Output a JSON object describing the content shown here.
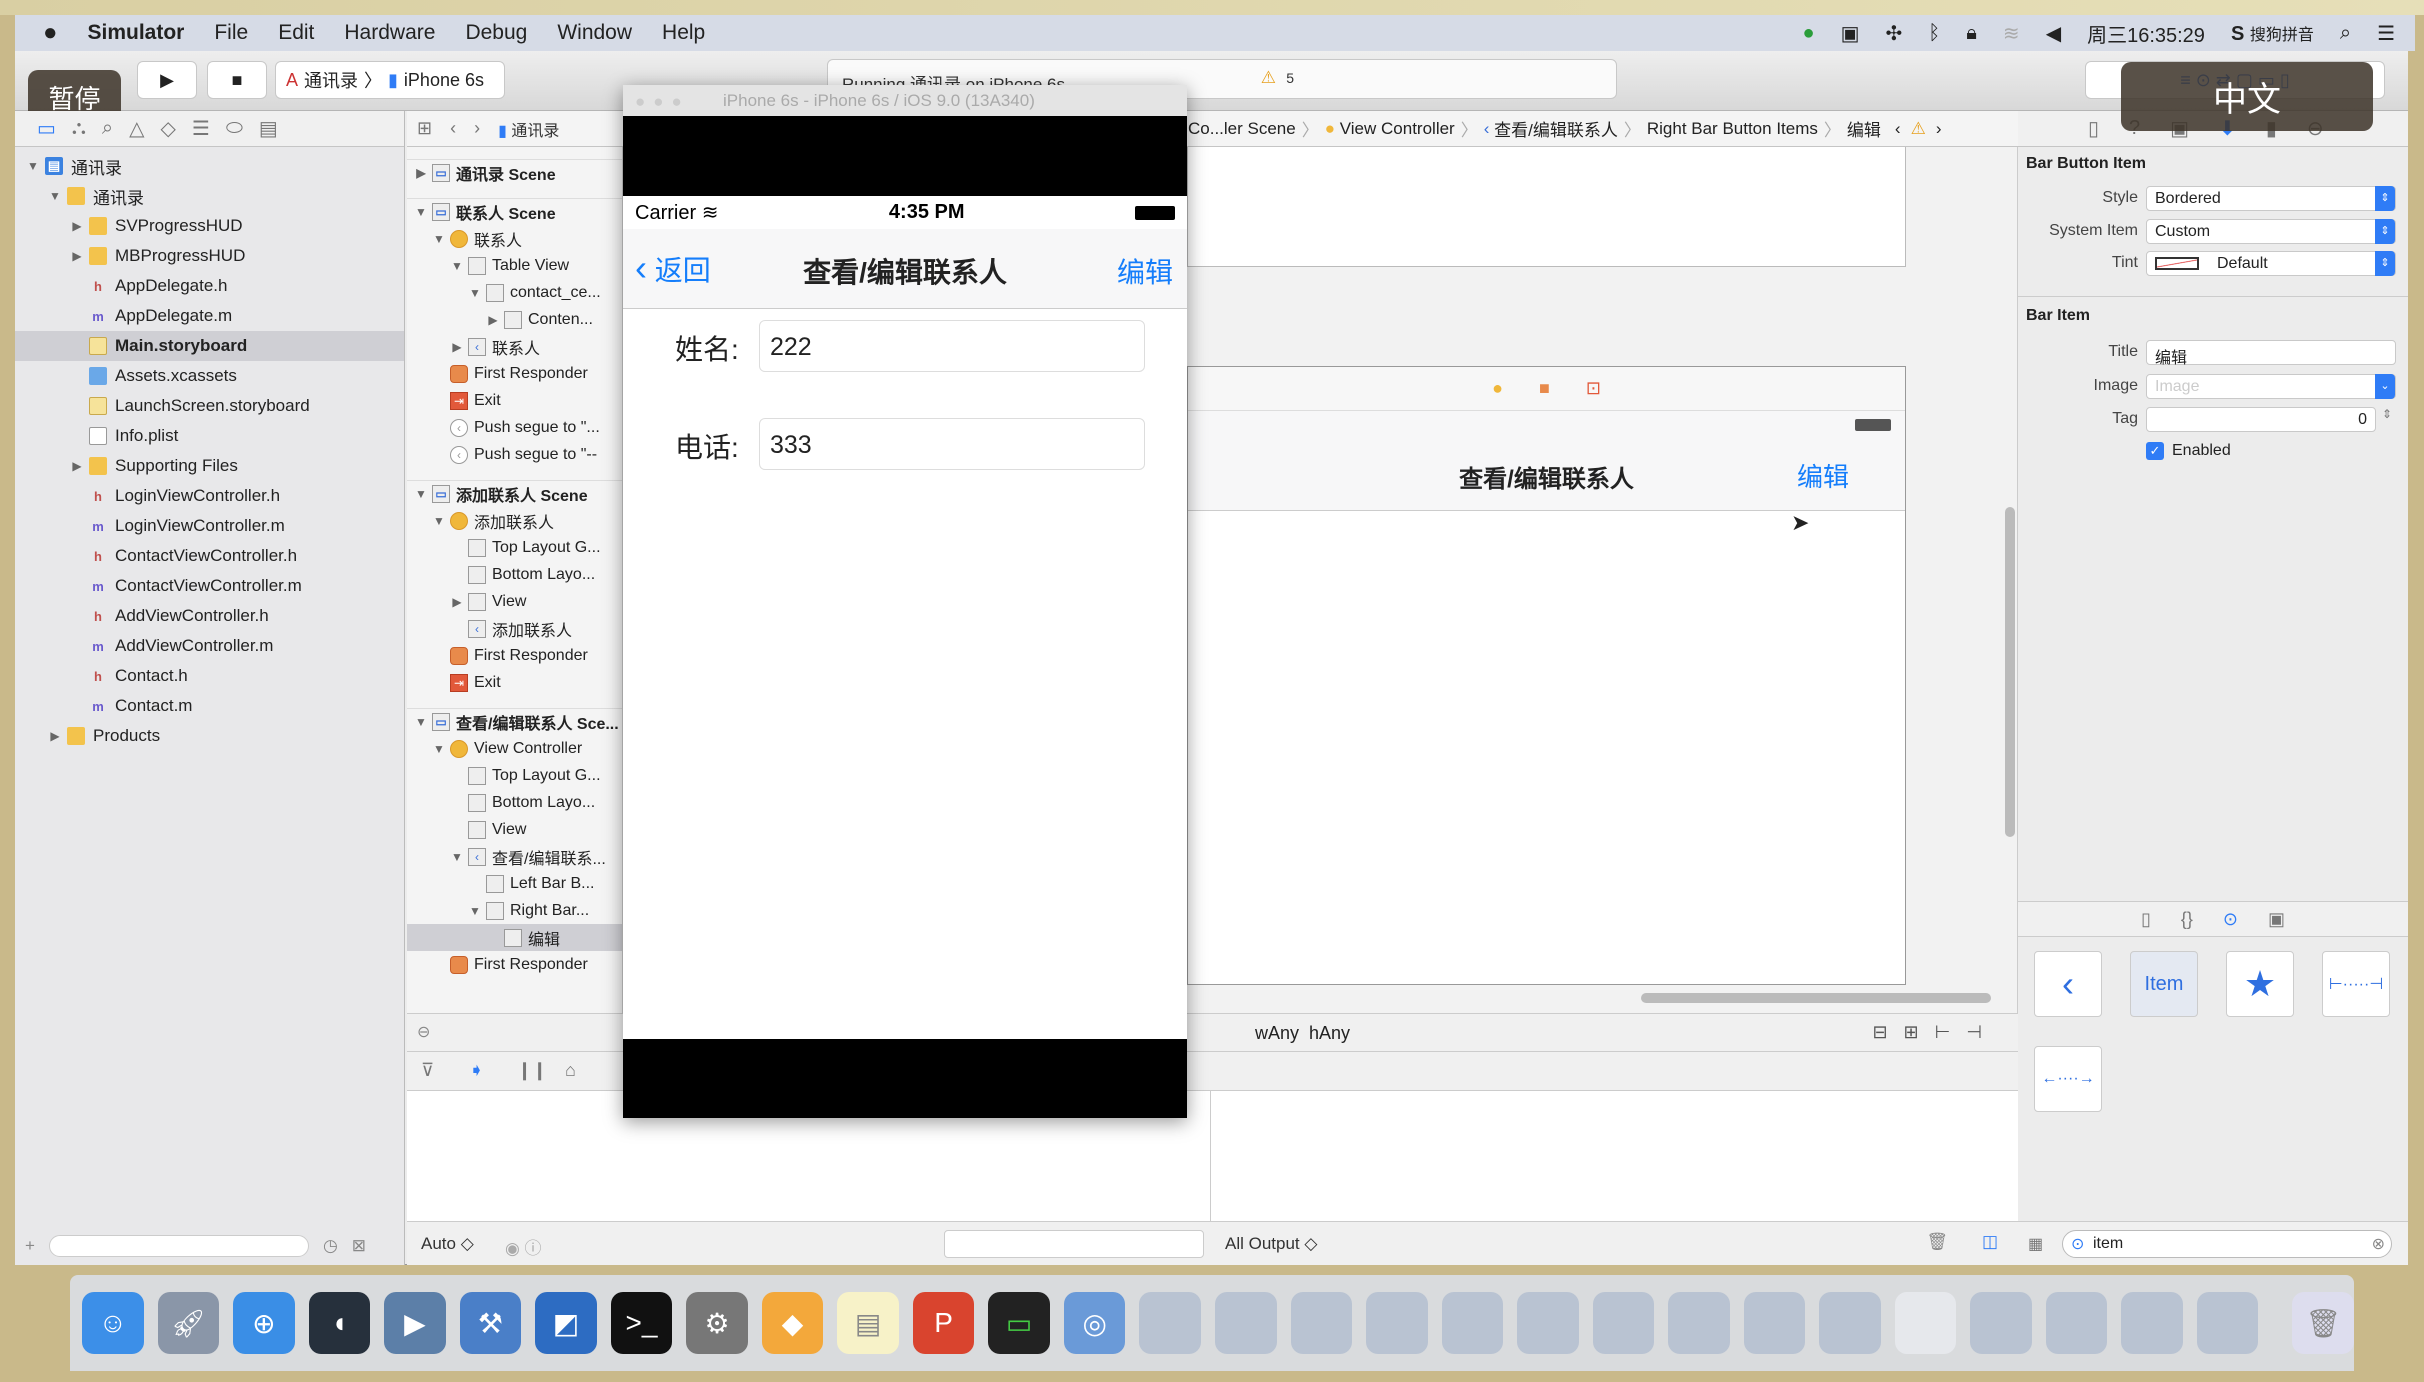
{
  "menubar": {
    "apple": "",
    "app": "Simulator",
    "items": [
      "File",
      "Edit",
      "Hardware",
      "Debug",
      "Window",
      "Help"
    ],
    "clock": "周三16:35:29",
    "ime": "搜狗拼音"
  },
  "toolbar": {
    "scheme": "通讯录",
    "device": "iPhone 6s",
    "activity": "Running 通讯录 on iPhone 6s",
    "warnings": "5"
  },
  "overlays": {
    "pause": "暂停",
    "lang": "中文"
  },
  "navigator": {
    "items": [
      {
        "label": "通讯录",
        "level": 0,
        "icon": "proj",
        "expanded": true
      },
      {
        "label": "通讯录",
        "level": 1,
        "icon": "folder",
        "expanded": true
      },
      {
        "label": "SVProgressHUD",
        "level": 2,
        "icon": "folder",
        "expanded": false
      },
      {
        "label": "MBProgressHUD",
        "level": 2,
        "icon": "folder",
        "expanded": false
      },
      {
        "label": "AppDelegate.h",
        "level": 2,
        "icon": "h"
      },
      {
        "label": "AppDelegate.m",
        "level": 2,
        "icon": "m"
      },
      {
        "label": "Main.storyboard",
        "level": 2,
        "icon": "sb",
        "selected": true
      },
      {
        "label": "Assets.xcassets",
        "level": 2,
        "icon": "assets"
      },
      {
        "label": "LaunchScreen.storyboard",
        "level": 2,
        "icon": "sb"
      },
      {
        "label": "Info.plist",
        "level": 2,
        "icon": "doc"
      },
      {
        "label": "Supporting Files",
        "level": 2,
        "icon": "folder",
        "expanded": false
      },
      {
        "label": "LoginViewController.h",
        "level": 2,
        "icon": "h"
      },
      {
        "label": "LoginViewController.m",
        "level": 2,
        "icon": "m"
      },
      {
        "label": "ContactViewController.h",
        "level": 2,
        "icon": "h"
      },
      {
        "label": "ContactViewController.m",
        "level": 2,
        "icon": "m"
      },
      {
        "label": "AddViewController.h",
        "level": 2,
        "icon": "h"
      },
      {
        "label": "AddViewController.m",
        "level": 2,
        "icon": "m"
      },
      {
        "label": "Contact.h",
        "level": 2,
        "icon": "h"
      },
      {
        "label": "Contact.m",
        "level": 2,
        "icon": "m"
      },
      {
        "label": "Products",
        "level": 1,
        "icon": "folder",
        "expanded": false
      }
    ]
  },
  "outline": {
    "items": [
      {
        "label": "通讯录 Scene",
        "level": 0,
        "icon": "scene",
        "expanded": false,
        "scene": true
      },
      {
        "label": "联系人 Scene",
        "level": 0,
        "icon": "scene",
        "expanded": true,
        "scene": true
      },
      {
        "label": "联系人",
        "level": 1,
        "icon": "vc",
        "expanded": true
      },
      {
        "label": "Table View",
        "level": 2,
        "icon": "view",
        "expanded": true
      },
      {
        "label": "contact_ce...",
        "level": 3,
        "icon": "view",
        "expanded": true
      },
      {
        "label": "Conten...",
        "level": 4,
        "icon": "view",
        "expanded": false
      },
      {
        "label": "联系人",
        "level": 2,
        "icon": "navitem",
        "expanded": false
      },
      {
        "label": "First Responder",
        "level": 1,
        "icon": "fr"
      },
      {
        "label": "Exit",
        "level": 1,
        "icon": "exit"
      },
      {
        "label": "Push segue to \"...",
        "level": 1,
        "icon": "segue"
      },
      {
        "label": "Push segue to \"--",
        "level": 1,
        "icon": "segue"
      },
      {
        "label": "添加联系人 Scene",
        "level": 0,
        "icon": "scene",
        "expanded": true,
        "scene": true
      },
      {
        "label": "添加联系人",
        "level": 1,
        "icon": "vc",
        "expanded": true
      },
      {
        "label": "Top Layout G...",
        "level": 2,
        "icon": "view"
      },
      {
        "label": "Bottom Layo...",
        "level": 2,
        "icon": "view"
      },
      {
        "label": "View",
        "level": 2,
        "icon": "view",
        "expanded": false
      },
      {
        "label": "添加联系人",
        "level": 2,
        "icon": "navitem"
      },
      {
        "label": "First Responder",
        "level": 1,
        "icon": "fr"
      },
      {
        "label": "Exit",
        "level": 1,
        "icon": "exit"
      },
      {
        "label": "查看/编辑联系人 Sce...",
        "level": 0,
        "icon": "scene",
        "expanded": true,
        "scene": true
      },
      {
        "label": "View Controller",
        "level": 1,
        "icon": "vc",
        "expanded": true
      },
      {
        "label": "Top Layout G...",
        "level": 2,
        "icon": "view"
      },
      {
        "label": "Bottom Layo...",
        "level": 2,
        "icon": "view"
      },
      {
        "label": "View",
        "level": 2,
        "icon": "view"
      },
      {
        "label": "查看/编辑联系...",
        "level": 2,
        "icon": "navitem",
        "expanded": true
      },
      {
        "label": "Left Bar B...",
        "level": 3,
        "icon": "view"
      },
      {
        "label": "Right Bar...",
        "level": 3,
        "icon": "view",
        "expanded": true
      },
      {
        "label": "编辑",
        "level": 4,
        "icon": "view",
        "selected": true
      },
      {
        "label": "First Responder",
        "level": 1,
        "icon": "fr"
      }
    ]
  },
  "jumpbar": {
    "first": "通讯录",
    "crumbs": [
      "Co...ler Scene",
      "View Controller",
      "查看/编辑联系人",
      "Right Bar Button Items",
      "编辑"
    ]
  },
  "simulator": {
    "title": "iPhone 6s - iPhone 6s / iOS 9.0 (13A340)",
    "carrier": "Carrier",
    "time": "4:35 PM",
    "back": "返回",
    "nav_title": "查看/编辑联系人",
    "edit": "编辑",
    "name_label": "姓名:",
    "name_value": "222",
    "phone_label": "电话:",
    "phone_value": "333"
  },
  "canvas": {
    "nav_title": "查看/编辑联系人",
    "edit": "编辑",
    "size_w": "wAny",
    "size_h": "hAny"
  },
  "debug": {
    "filter": "Auto ◇",
    "output": "All Output ◇"
  },
  "inspector": {
    "section1": "Bar Button Item",
    "style_label": "Style",
    "style": "Bordered",
    "system_label": "System Item",
    "system": "Custom",
    "tint_label": "Tint",
    "tint": "Default",
    "section2": "Bar Item",
    "title_label": "Title",
    "title": "编辑",
    "image_label": "Image",
    "image_placeholder": "Image",
    "tag_label": "Tag",
    "tag": "0",
    "enabled_label": "Enabled",
    "enabled": true,
    "library_item": "Item",
    "search": "item"
  },
  "colors": {
    "accent": "#2f7cf6",
    "ios_tint": "#157efb"
  }
}
